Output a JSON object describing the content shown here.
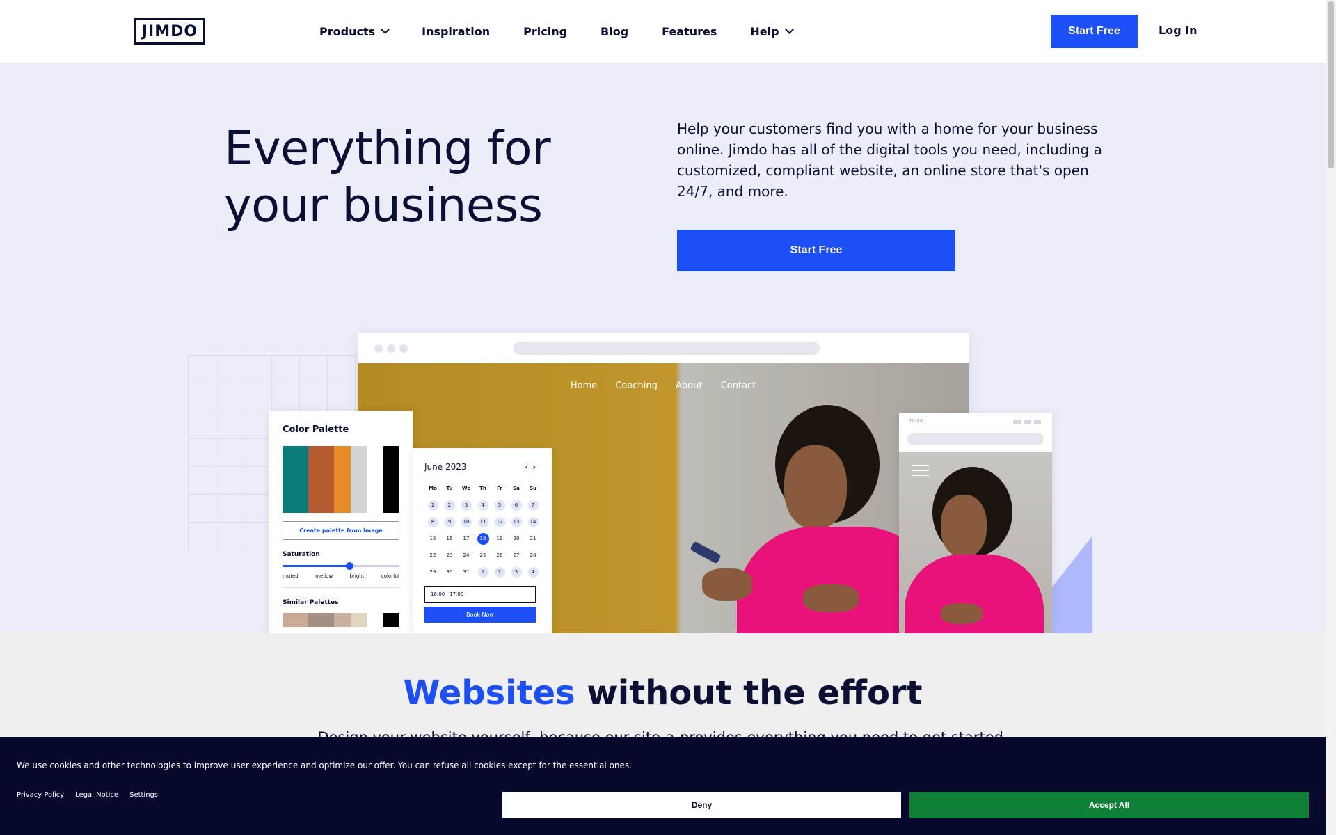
{
  "header": {
    "logo": "JIMDO",
    "nav": [
      {
        "label": "Products",
        "dropdown": true
      },
      {
        "label": "Inspiration",
        "dropdown": false
      },
      {
        "label": "Pricing",
        "dropdown": false
      },
      {
        "label": "Blog",
        "dropdown": false
      },
      {
        "label": "Features",
        "dropdown": false
      },
      {
        "label": "Help",
        "dropdown": true
      }
    ],
    "start_free": "Start Free",
    "log_in": "Log In"
  },
  "hero": {
    "title": "Everything for your business",
    "description": "Help your customers find you with a home for your business online. Jimdo has all of the digital tools you need, including a customized, compliant website, an online store that's open 24/7, and more.",
    "cta": "Start Free"
  },
  "mockup": {
    "site_nav": [
      "Home",
      "Coaching",
      "About",
      "Contact"
    ],
    "palette": {
      "title": "Color Palette",
      "swatches": [
        "#0b7b77",
        "#b65a31",
        "#e58c28",
        "#d3d3d3",
        "#000000"
      ],
      "button": "Create palette from image",
      "saturation_label": "Saturation",
      "saturation_level": 0.57,
      "saturation_options": [
        "muted",
        "mellow",
        "bright",
        "colorful"
      ],
      "similar_label": "Similar Palettes",
      "similar_swatches": [
        "#c9aa96",
        "#a48f84",
        "#c8b29e",
        "#e0d6c0",
        "#000000"
      ]
    },
    "calendar": {
      "month": "June 2023",
      "weekdays": [
        "Mo",
        "Tu",
        "We",
        "Th",
        "Fr",
        "Sa",
        "Su"
      ],
      "days": [
        "1",
        "2",
        "3",
        "4",
        "5",
        "6",
        "7",
        "8",
        "9",
        "10",
        "11",
        "12",
        "13",
        "14",
        "15",
        "16",
        "17",
        "18",
        "19",
        "20",
        "21",
        "22",
        "23",
        "24",
        "25",
        "26",
        "27",
        "28",
        "29",
        "30",
        "31",
        "1",
        "2",
        "3",
        "4"
      ],
      "selected_day": "18",
      "time_slot": "16:00 - 17:00",
      "book_button": "Book Now"
    },
    "phone": {
      "time": "10:08"
    }
  },
  "section2": {
    "title_accent": "Websites",
    "title_rest": " without the effort",
    "subtitle": "Design your website yourself, because our site-a-provides everything you need to get started."
  },
  "cookie": {
    "text": "We use cookies and other technologies to improve user experience and optimize our offer. You can refuse all cookies except for the essential ones.",
    "links": [
      "Privacy Policy",
      "Legal Notice",
      "Settings"
    ],
    "deny": "Deny",
    "accept": "Accept All"
  },
  "colors": {
    "brand_blue": "#1d4ff7",
    "navy": "#0b0f33",
    "accept_green": "#0f7f37",
    "banner_bg": "#06092b"
  }
}
